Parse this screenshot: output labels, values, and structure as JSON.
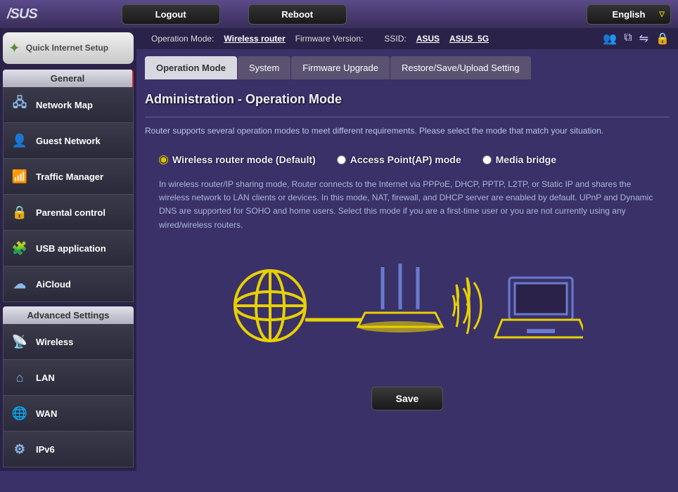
{
  "brand": "/SUS",
  "top_buttons": {
    "logout": "Logout",
    "reboot": "Reboot",
    "language": "English"
  },
  "infobar": {
    "op_mode_label": "Operation Mode:",
    "op_mode_value": "Wireless router",
    "fw_label": "Firmware Version:",
    "ssid_label": "SSID:",
    "ssid1": "ASUS",
    "ssid2": "ASUS_5G"
  },
  "sidebar": {
    "qis": "Quick Internet Setup",
    "general_hdr": "General",
    "general": [
      {
        "label": "Network Map",
        "icon": "network-map-icon"
      },
      {
        "label": "Guest Network",
        "icon": "guest-network-icon"
      },
      {
        "label": "Traffic Manager",
        "icon": "traffic-manager-icon"
      },
      {
        "label": "Parental control",
        "icon": "parental-control-icon"
      },
      {
        "label": "USB application",
        "icon": "usb-application-icon"
      },
      {
        "label": "AiCloud",
        "icon": "aicloud-icon"
      }
    ],
    "advanced_hdr": "Advanced Settings",
    "advanced": [
      {
        "label": "Wireless",
        "icon": "wireless-icon"
      },
      {
        "label": "LAN",
        "icon": "lan-icon"
      },
      {
        "label": "WAN",
        "icon": "wan-icon"
      },
      {
        "label": "IPv6",
        "icon": "ipv6-icon"
      }
    ]
  },
  "tabs": [
    {
      "label": "Operation Mode",
      "active": true
    },
    {
      "label": "System",
      "active": false
    },
    {
      "label": "Firmware Upgrade",
      "active": false
    },
    {
      "label": "Restore/Save/Upload Setting",
      "active": false
    }
  ],
  "page": {
    "title": "Administration - Operation Mode",
    "desc": "Router supports several operation modes to meet different requirements. Please select the mode that match your situation.",
    "modes": [
      {
        "label": "Wireless router mode (Default)",
        "selected": true
      },
      {
        "label": "Access Point(AP) mode",
        "selected": false
      },
      {
        "label": "Media bridge",
        "selected": false
      }
    ],
    "mode_desc": "In wireless router/IP sharing mode, Router connects to the Internet via PPPoE, DHCP, PPTP, L2TP, or Static IP and shares the wireless network to LAN clients or devices. In this mode, NAT, firewall, and DHCP server are enabled by default. UPnP and Dynamic DNS are supported for SOHO and home users. Select this mode if you are a first-time user or you are not currently using any wired/wireless routers.",
    "save": "Save"
  }
}
